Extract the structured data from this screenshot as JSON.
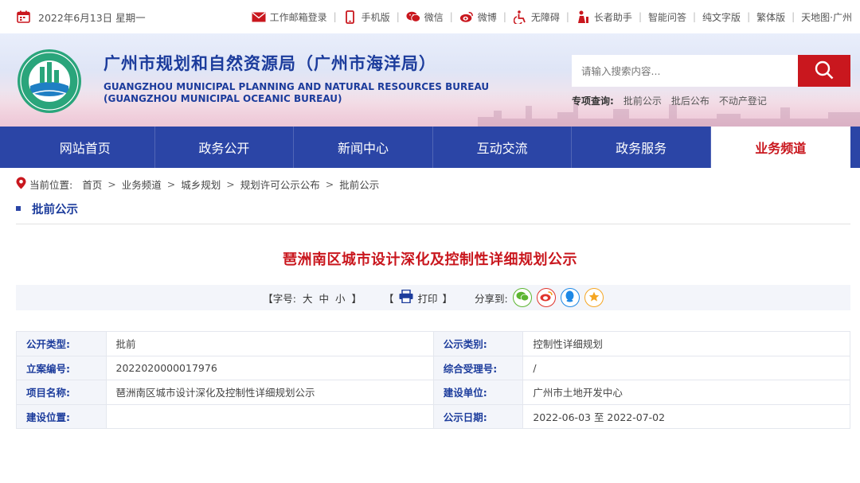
{
  "topbar": {
    "date": "2022年6月13日 星期一",
    "links": [
      {
        "label": "工作邮箱登录",
        "icon": "mail-icon"
      },
      {
        "label": "手机版",
        "icon": "mobile-icon"
      },
      {
        "label": "微信",
        "icon": "wechat-icon"
      },
      {
        "label": "微博",
        "icon": "weibo-icon"
      },
      {
        "label": "无障碍",
        "icon": "accessibility-icon"
      },
      {
        "label": "长者助手",
        "icon": "elder-icon"
      },
      {
        "label": "智能问答"
      },
      {
        "label": "纯文字版"
      },
      {
        "label": "繁体版"
      },
      {
        "label": "天地图·广州"
      }
    ]
  },
  "header": {
    "org_cn": "广州市规划和自然资源局（广州市海洋局）",
    "org_en_1": "GUANGZHOU MUNICIPAL PLANNING AND NATURAL RESOURCES BUREAU",
    "org_en_2": "(GUANGZHOU MUNICIPAL OCEANIC BUREAU)",
    "search_placeholder": "请输入搜索内容...",
    "special_label": "专项查询:",
    "special_links": [
      "批前公示",
      "批后公布",
      "不动产登记"
    ]
  },
  "nav": {
    "items": [
      "网站首页",
      "政务公开",
      "新闻中心",
      "互动交流",
      "政务服务",
      "业务频道"
    ],
    "active_index": 5
  },
  "breadcrumb": {
    "label": "当前位置:",
    "items": [
      "首页",
      "业务频道",
      "城乡规划",
      "规划许可公示公布",
      "批前公示"
    ]
  },
  "section_title": "批前公示",
  "article": {
    "title": "琶洲南区城市设计深化及控制性详细规划公示",
    "font_label": "【字号:",
    "font_sizes": [
      "大",
      "中",
      "小"
    ],
    "font_close": "】",
    "print_open": "【",
    "print_label": "打印",
    "print_close": "】",
    "share_label": "分享到:"
  },
  "info_table": [
    {
      "k1": "公开类型:",
      "v1": "批前",
      "k2": "公示类别:",
      "v2": "控制性详细规划"
    },
    {
      "k1": "立案编号:",
      "v1": "2022020000017976",
      "k2": "综合受理号:",
      "v2": "/"
    },
    {
      "k1": "项目名称:",
      "v1": "琶洲南区城市设计深化及控制性详细规划公示",
      "k2": "建设单位:",
      "v2": "广州市土地开发中心"
    },
    {
      "k1": "建设位置:",
      "v1": "",
      "k2": "公示日期:",
      "v2": "2022-06-03 至 2022-07-02"
    }
  ],
  "colors": {
    "brand_blue": "#2b45a6",
    "accent_red": "#c9171e"
  }
}
